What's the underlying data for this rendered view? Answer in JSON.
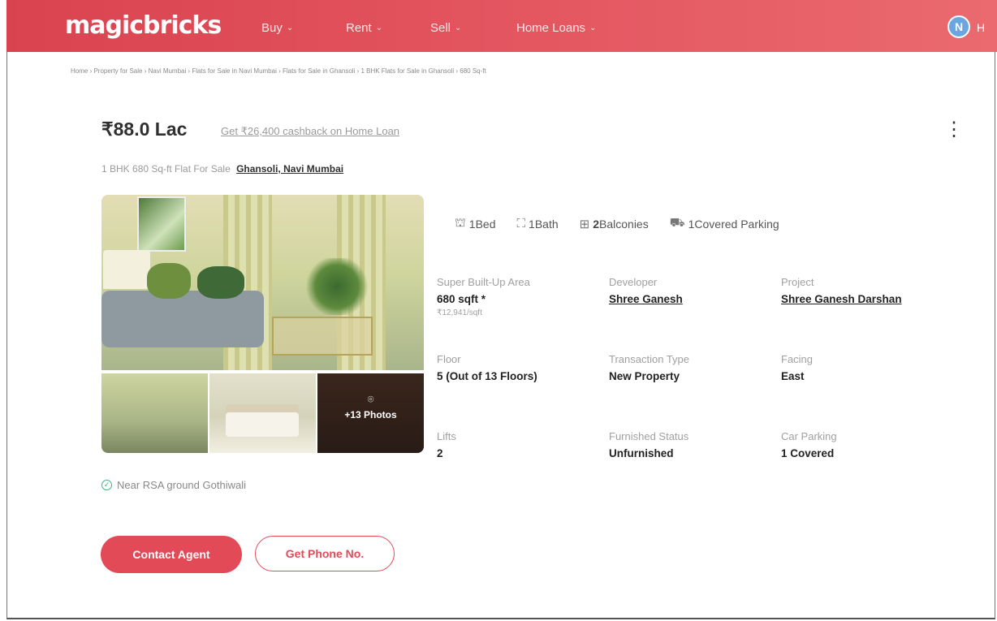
{
  "brand": {
    "logo_text": "magicbricks"
  },
  "nav": {
    "items": [
      {
        "label": "Buy"
      },
      {
        "label": "Rent"
      },
      {
        "label": "Sell"
      },
      {
        "label": "Home Loans"
      }
    ],
    "chevron": "⌄"
  },
  "user": {
    "initial": "N",
    "trailing": "H"
  },
  "breadcrumb": "Home › Property for Sale › Navi Mumbai › Flats for Sale in Navi Mumbai › Flats for Sale in Ghansoli › 1 BHK Flats for Sale in Ghansoli › 680 Sq-ft",
  "listing": {
    "price": "₹88.0 Lac",
    "cashback": "Get ₹26,400 cashback on Home Loan",
    "subtitle": "1 BHK 680 Sq-ft Flat For Sale",
    "location": "Ghansoli, Navi Mumbai",
    "more_menu": "⋮"
  },
  "gallery": {
    "more_photos": "+13 Photos",
    "camera": "⌾"
  },
  "features": [
    {
      "icon": "bed-icon",
      "glyph": "⛫",
      "value": "1",
      "label": "Bed"
    },
    {
      "icon": "bath-icon",
      "glyph": "⛶",
      "value": "1",
      "label": "Bath"
    },
    {
      "icon": "balcony-icon",
      "glyph": "⊞",
      "value": "2",
      "label": "Balconies"
    },
    {
      "icon": "parking-icon",
      "glyph": "⛟",
      "value": "1",
      "label": "Covered Parking"
    }
  ],
  "details": [
    {
      "label": "Super Built-Up Area",
      "value": "680 sqft",
      "marker": "*",
      "sub": "₹12,941/sqft"
    },
    {
      "label": "Developer",
      "value": "Shree Ganesh",
      "link": true
    },
    {
      "label": "Project",
      "value": "Shree Ganesh Darshan",
      "link": true
    },
    {
      "label": "Floor",
      "value": "5 (Out of 13 Floors)"
    },
    {
      "label": "Transaction Type",
      "value": "New Property"
    },
    {
      "label": "Facing",
      "value": "East"
    },
    {
      "label": "Lifts",
      "value": "2"
    },
    {
      "label": "Furnished Status",
      "value": "Unfurnished"
    },
    {
      "label": "Car Parking",
      "value": "1 Covered"
    }
  ],
  "landmark": "Near RSA ground Gothiwali",
  "actions": {
    "contact": "Contact Agent",
    "phone": "Get Phone No."
  },
  "colors": {
    "brand": "#e24a57",
    "success": "#3db67a"
  }
}
